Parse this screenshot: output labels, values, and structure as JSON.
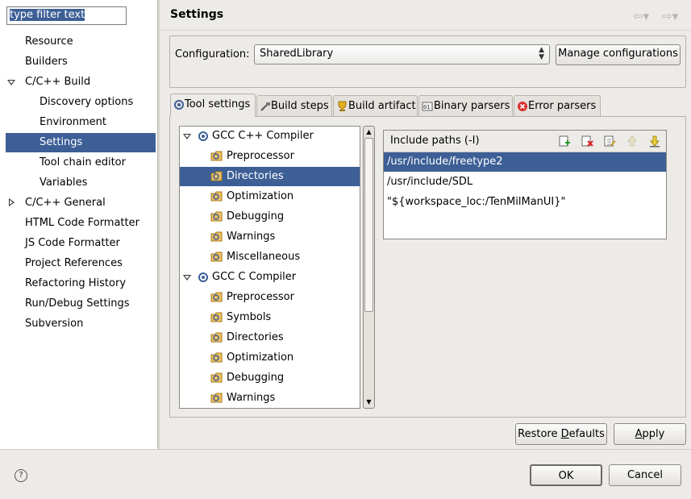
{
  "filter": {
    "placeholder": "type filter text"
  },
  "nav": {
    "items": [
      {
        "label": "Resource"
      },
      {
        "label": "Builders"
      },
      {
        "label": "C/C++ Build"
      },
      {
        "label": "Discovery options"
      },
      {
        "label": "Environment"
      },
      {
        "label": "Settings"
      },
      {
        "label": "Tool chain editor"
      },
      {
        "label": "Variables"
      },
      {
        "label": "C/C++ General"
      },
      {
        "label": "HTML Code Formatter"
      },
      {
        "label": "JS Code Formatter"
      },
      {
        "label": "Project References"
      },
      {
        "label": "Refactoring History"
      },
      {
        "label": "Run/Debug Settings"
      },
      {
        "label": "Subversion"
      }
    ]
  },
  "header": {
    "title": "Settings"
  },
  "config": {
    "label": "Configuration:",
    "value": "SharedLibrary",
    "manage_label": "Manage configurations"
  },
  "tabs": [
    {
      "label": "Tool settings",
      "icon": "tool-settings-icon"
    },
    {
      "label": "Build steps",
      "icon": "build-steps-icon"
    },
    {
      "label": "Build artifact",
      "icon": "trophy-icon"
    },
    {
      "label": "Binary parsers",
      "icon": "binary-icon"
    },
    {
      "label": "Error parsers",
      "icon": "error-icon"
    }
  ],
  "tree": {
    "cpp_compiler": "GCC C++ Compiler",
    "cpp_children": [
      "Preprocessor",
      "Directories",
      "Optimization",
      "Debugging",
      "Warnings",
      "Miscellaneous"
    ],
    "c_compiler": "GCC C Compiler",
    "c_children": [
      "Preprocessor",
      "Symbols",
      "Directories",
      "Optimization",
      "Debugging",
      "Warnings"
    ]
  },
  "include": {
    "header": "Include paths (-I)",
    "paths": [
      "/usr/include/freetype2",
      "/usr/include/SDL",
      "\"${workspace_loc:/TenMilManUI}\""
    ]
  },
  "buttons": {
    "restore_pre": "Restore ",
    "restore_key": "D",
    "restore_post": "efaults",
    "apply_key": "A",
    "apply_post": "pply",
    "ok": "OK",
    "cancel": "Cancel"
  },
  "colors": {
    "selection": "#3d5f96",
    "panel": "#edebe7"
  }
}
